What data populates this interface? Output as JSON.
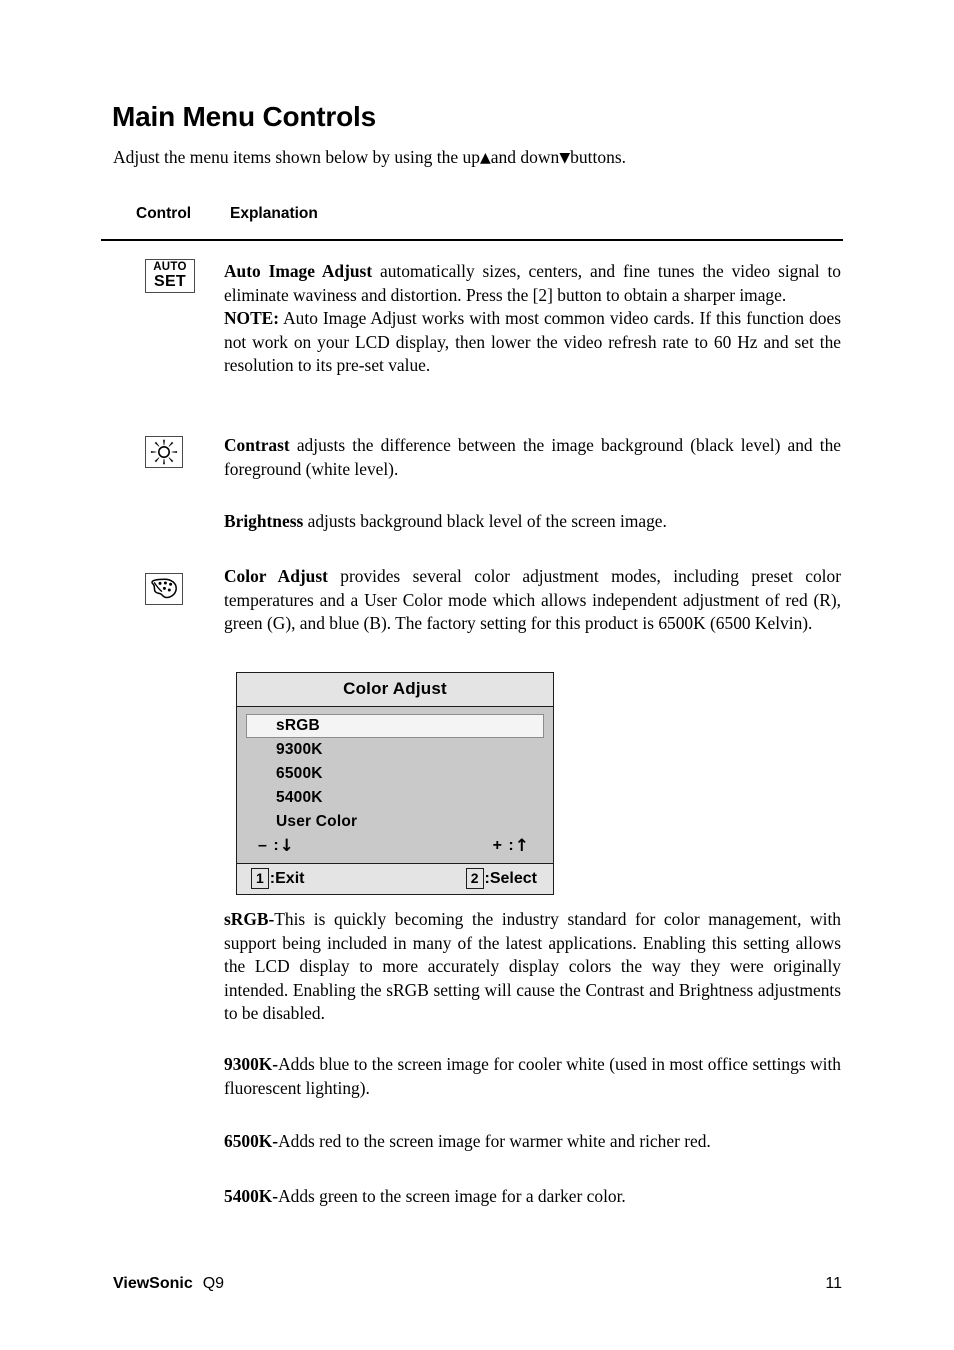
{
  "document": {
    "title": "Main Menu Controls",
    "intro_before": "Adjust the menu items shown below by using the up",
    "intro_mid": "and down",
    "intro_after": "buttons.",
    "up_arrow": "▲",
    "down_arrow": "▼"
  },
  "table": {
    "header_control": "Control",
    "header_explanation": "Explanation"
  },
  "rows": [
    {
      "icon_name": "auto-set-icon",
      "icon_line1": "AUTO",
      "icon_line2": "SET",
      "paragraphs": [
        {
          "bold": "Auto Image Adjust",
          "text": " automatically sizes, centers, and fine tunes the video signal to eliminate waviness and distortion. Press the [2] button to obtain a sharper image."
        },
        {
          "bold": "NOTE:",
          "text": " Auto Image Adjust works with most common video cards. If this function does not work on your LCD display, then lower the video refresh rate to 60 Hz and set the resolution to its pre-set value."
        }
      ]
    },
    {
      "icon_name": "contrast-sun-icon",
      "paragraphs": [
        {
          "bold": "Contrast",
          "text": " adjusts the difference between the image background  (black level) and the foreground (white level)."
        },
        {
          "bold": "Brightness",
          "text": " adjusts background black level of the screen image."
        }
      ]
    },
    {
      "icon_name": "color-palette-icon",
      "paragraphs": [
        {
          "bold": "Color Adjust",
          "text": " provides several color adjustment modes, including preset color temperatures and a User Color mode which allows independent adjustment of red (R), green (G), and blue (B). The factory setting for this product is 6500K (6500 Kelvin)."
        }
      ]
    }
  ],
  "osd": {
    "title": "Color Adjust",
    "items": [
      {
        "label": "sRGB",
        "selected": true
      },
      {
        "label": "9300K",
        "selected": false
      },
      {
        "label": "6500K",
        "selected": false
      },
      {
        "label": "5400K",
        "selected": false
      },
      {
        "label": "User Color",
        "selected": false
      }
    ],
    "minus_label": "– :",
    "minus_glyph": "↓",
    "plus_label": "+ :",
    "plus_glyph": "↑",
    "exit_key": "1",
    "exit_label": ":Exit",
    "select_key": "2",
    "select_label": ":Select"
  },
  "color_descriptions": [
    {
      "bold": "sRGB-",
      "text": "This is quickly becoming the industry standard for color management, with support being included in many of the latest applications. Enabling this setting allows the LCD display to more accurately display colors the way they were originally intended. Enabling the sRGB setting will cause the Contrast and Brightness adjustments to be disabled."
    },
    {
      "bold": "9300K-",
      "text": "Adds blue to the screen image for cooler white (used in most office settings with fluorescent lighting)."
    },
    {
      "bold": "6500K-",
      "text": "Adds red to the screen image for warmer white and richer red."
    },
    {
      "bold": "5400K-",
      "text": "Adds green to the screen image for a darker color."
    }
  ],
  "footer": {
    "brand": "ViewSonic",
    "model": "Q9",
    "page_number": "11"
  },
  "colors": {
    "osd_title_bg": "#e4e4e4",
    "osd_body_bg": "#c9c9c9",
    "osd_selected_bg": "#f4f4f4",
    "osd_border": "#1d1d1d",
    "text": "#000000",
    "page_bg": "#ffffff"
  }
}
